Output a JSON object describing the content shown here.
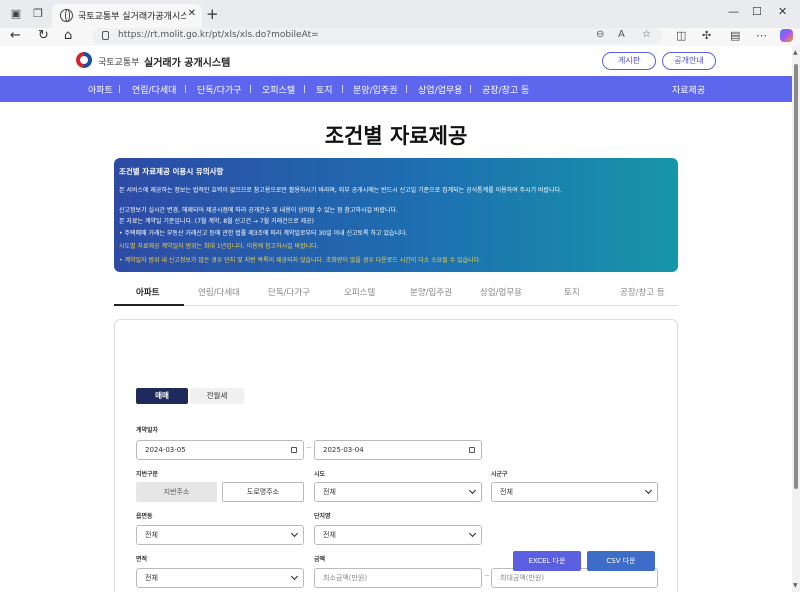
{
  "browser": {
    "tab_title": "국토교통부 실거래가공개시스템",
    "url": "https://rt.molit.go.kr/pt/xls/xls.do?mobileAt=",
    "new_tab_label": "+",
    "close_tab_label": "✕"
  },
  "header": {
    "ministry": "국토교통부",
    "system_name": "실거래가 공개시스템",
    "buttons": [
      "게시판",
      "공개안내"
    ]
  },
  "menu": {
    "items": [
      "아파트",
      "연립/다세대",
      "단독/다가구",
      "오피스텔",
      "토지",
      "분양/입주권",
      "상업/업무용",
      "공장/창고 등"
    ],
    "right_item": "자료제공"
  },
  "page_title": "조건별 자료제공",
  "notice": {
    "heading": "조건별 자료제공 이용시 유의사항",
    "lines": [
      "본 서비스에 제공하는 정보는 법적인 효력이 없으므로 참고용으로만 활용하시기 바라며, 외부 공개시에는 반드시 신고일 기준으로 집계되는 공식통계를 이용하여 주시기 바랍니다.",
      "신고정보가 실시간 변경, 해제되어 제공시점에 따라 공개건수 및 내용이 상이할 수 있는 점 참고하시길 바랍니다.",
      "본 자료는 계약일 기준입니다. (7월 계약, 8월 신고건 → 7월 거래건으로 제공)",
      "• 주택매매 거래는 부동산 거래신고 등에 관한 법률 제3조에 따라 계약일로부터 30일 이내 신고토록 하고 있습니다.",
      "시도별 자료제공 계약일자 범위는 최대 1년입니다. 이용에 참고하시길 바랍니다.",
      "• 계약일자 범위 내 신고정보가 많은 경우 단지 및 지번 목록이 제공되지 않습니다. 조회량이 많을 경우 다운로드 시간이 다소 소요될 수 있습니다."
    ]
  },
  "tabs": [
    "아파트",
    "연립/다세대",
    "단독/다가구",
    "오피스텔",
    "분양/입주권",
    "상업/업무용",
    "토지",
    "공장/창고 등"
  ],
  "form": {
    "deal_types": [
      "매매",
      "전월세"
    ],
    "labels": {
      "contract_date": "계약일자",
      "address_type": "지번구분",
      "sido": "시도",
      "sigungu": "시군구",
      "eupmyeondong": "읍면동",
      "complex": "단지명",
      "area": "면적",
      "amount": "금액"
    },
    "date_from": "2024-03-05",
    "date_to": "2025-03-04",
    "address_types": [
      "지번주소",
      "도로명주소"
    ],
    "sido_value": "전체",
    "sigungu_value": "전체",
    "eupmyeondong_value": "전체",
    "complex_value": "전체",
    "area_value": "전체",
    "amount_min_placeholder": "최소금액(만원)",
    "amount_max_placeholder": "최대금액(만원)",
    "range_sep": "~",
    "excel_button": "EXCEL 다운",
    "csv_button": "CSV 다운"
  },
  "colors": {
    "menu_bg": "#5e66ee",
    "excel_button": "#5b5fe0",
    "csv_button": "#3d6cc9",
    "deal_active": "#1e2a5c"
  }
}
